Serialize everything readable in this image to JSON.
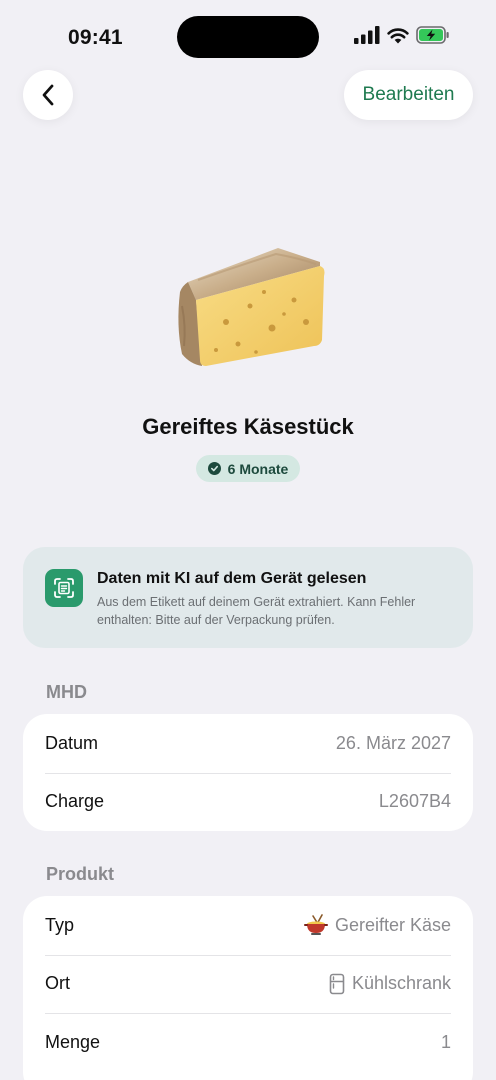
{
  "status_bar": {
    "time": "09:41"
  },
  "nav": {
    "back_label": "Zurück",
    "edit_label": "Bearbeiten"
  },
  "product": {
    "image_icon": "cheese-wedge",
    "title": "Gereiftes Käsestück",
    "shelf_life_badge": "6 Monate"
  },
  "ai_notice": {
    "icon": "document-scan-icon",
    "title": "Daten mit KI auf dem Gerät gelesen",
    "description": "Aus dem Etikett auf deinem Gerät extrahiert. Kann Fehler enthalten: Bitte auf der Verpackung prüfen."
  },
  "mhd_section": {
    "header": "MHD",
    "rows": [
      {
        "label": "Datum",
        "value": "26. März 2027"
      },
      {
        "label": "Charge",
        "value": "L2607B4"
      }
    ]
  },
  "product_section": {
    "header": "Produkt",
    "rows": [
      {
        "label": "Typ",
        "value": "Gereifter Käse",
        "icon": "fondue-pot-icon"
      },
      {
        "label": "Ort",
        "value": "Kühlschrank",
        "icon": "fridge-icon"
      },
      {
        "label": "Menge",
        "value": "1"
      }
    ]
  },
  "colors": {
    "background": "#f1f0f5",
    "accent_green": "#1f7a50",
    "badge_bg": "#d4e8e2",
    "ai_card_bg": "#e1e9eb",
    "ai_icon_bg": "#2a9a6c"
  }
}
